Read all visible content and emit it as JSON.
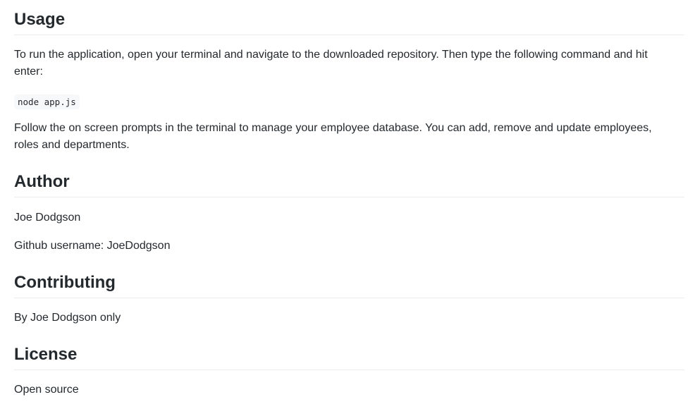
{
  "usage": {
    "heading": "Usage",
    "intro": "To run the application, open your terminal and navigate to the downloaded repository. Then type the following command and hit enter:",
    "command": "node app.js",
    "followup": "Follow the on screen prompts in the terminal to manage your employee database. You can add, remove and update employees, roles and departments."
  },
  "author": {
    "heading": "Author",
    "name": "Joe Dodgson",
    "github": "Github username: JoeDodgson"
  },
  "contributing": {
    "heading": "Contributing",
    "text": "By Joe Dodgson only"
  },
  "license": {
    "heading": "License",
    "text": "Open source"
  }
}
